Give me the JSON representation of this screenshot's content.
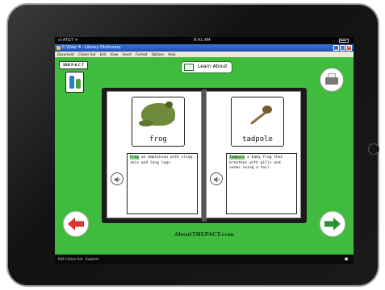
{
  "status_bar": {
    "carrier": "ııl AT&T ᯤ",
    "time": "9:41 AM"
  },
  "window": {
    "title": "C:\\User 4 - Library Dictionary"
  },
  "menu": [
    "Document",
    "Clicker Set",
    "Edit",
    "View",
    "Insert",
    "Format",
    "Options",
    "Help"
  ],
  "header": {
    "logo_text": "SSR P A C T",
    "learn_about_label": "Learn About"
  },
  "book": {
    "left_page": {
      "word": "frog",
      "highlight": "Frog",
      "sentence": " an amphibian with slimy skin and long legs."
    },
    "right_page": {
      "word": "tadpole",
      "highlight": "Tadpole",
      "sentence": " a baby frog that breathes with gills and swims using a tail."
    }
  },
  "watermark": "AboutTHEPACT.com",
  "taskbar": {
    "edit_clicker_set": "Edit Clicker Set",
    "explorer": "Explorer"
  },
  "icons": {
    "printer": "printer-icon",
    "speaker": "speaker-icon",
    "prev": "arrow-left-icon",
    "next": "arrow-right-icon",
    "settings": "gear-icon"
  },
  "colors": {
    "background": "#3fbc3d",
    "highlight": "#7fd87d",
    "prev_arrow": "#e0322b",
    "next_arrow": "#2f8f3a"
  }
}
